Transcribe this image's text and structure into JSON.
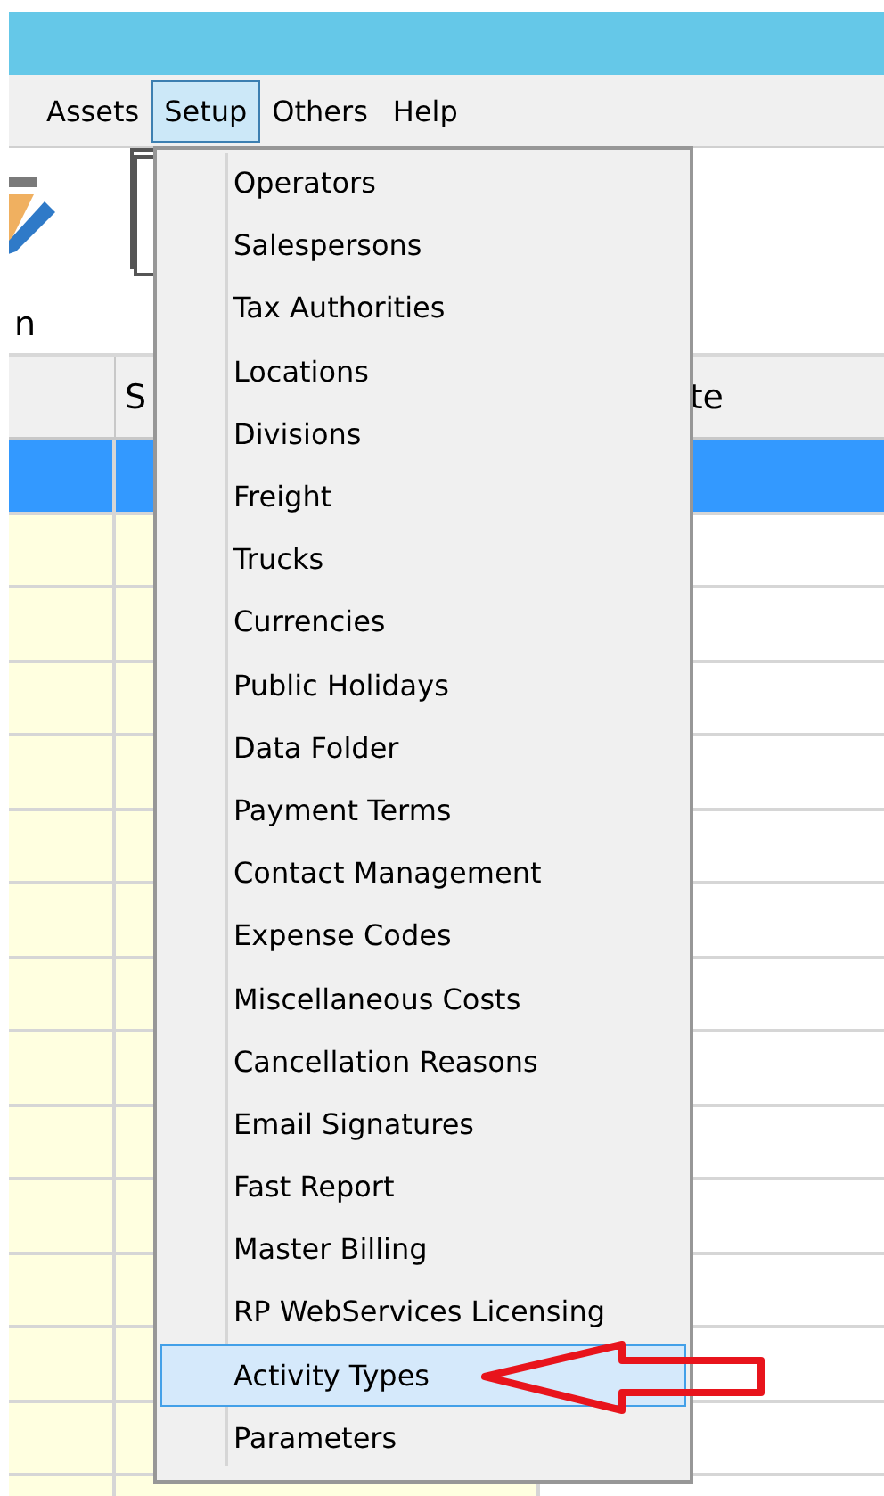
{
  "menu_bar": [
    {
      "label": "Assets",
      "selected": false
    },
    {
      "label": "Setup",
      "selected": true
    },
    {
      "label": "Others",
      "selected": false
    },
    {
      "label": "Help",
      "selected": false
    }
  ],
  "toolbar": [
    {
      "label": "n",
      "kind": "pencil"
    },
    {
      "kind": "frame"
    }
  ],
  "grid": {
    "columns": [
      "",
      "S",
      "te"
    ],
    "rows": [
      {
        "selected": true
      },
      {
        "selected": false
      },
      {
        "selected": false
      },
      {
        "selected": false
      },
      {
        "selected": false
      },
      {
        "selected": false
      },
      {
        "selected": false
      },
      {
        "selected": false
      },
      {
        "selected": false
      },
      {
        "selected": false
      },
      {
        "selected": false
      },
      {
        "selected": false
      },
      {
        "selected": false
      },
      {
        "selected": false
      },
      {
        "selected": false
      }
    ]
  },
  "dropdown": {
    "items": [
      {
        "label": "Operators",
        "selected": false
      },
      {
        "label": "Salespersons",
        "selected": false
      },
      {
        "label": "Tax Authorities",
        "selected": false
      },
      {
        "label": "Locations",
        "selected": false
      },
      {
        "label": "Divisions",
        "selected": false
      },
      {
        "label": "Freight",
        "selected": false
      },
      {
        "label": "Trucks",
        "selected": false
      },
      {
        "label": "Currencies",
        "selected": false
      },
      {
        "label": "Public Holidays",
        "selected": false
      },
      {
        "label": "Data Folder",
        "selected": false
      },
      {
        "label": "Payment Terms",
        "selected": false
      },
      {
        "label": "Contact Management",
        "selected": false
      },
      {
        "label": "Expense Codes",
        "selected": false
      },
      {
        "label": "Miscellaneous Costs",
        "selected": false
      },
      {
        "label": "Cancellation Reasons",
        "selected": false
      },
      {
        "label": "Email Signatures",
        "selected": false
      },
      {
        "label": "Fast Report",
        "selected": false
      },
      {
        "label": "Master Billing",
        "selected": false
      },
      {
        "label": "RP WebServices Licensing",
        "selected": false
      },
      {
        "label": "Activity Types",
        "selected": true
      },
      {
        "label": "Parameters",
        "selected": false
      }
    ]
  }
}
